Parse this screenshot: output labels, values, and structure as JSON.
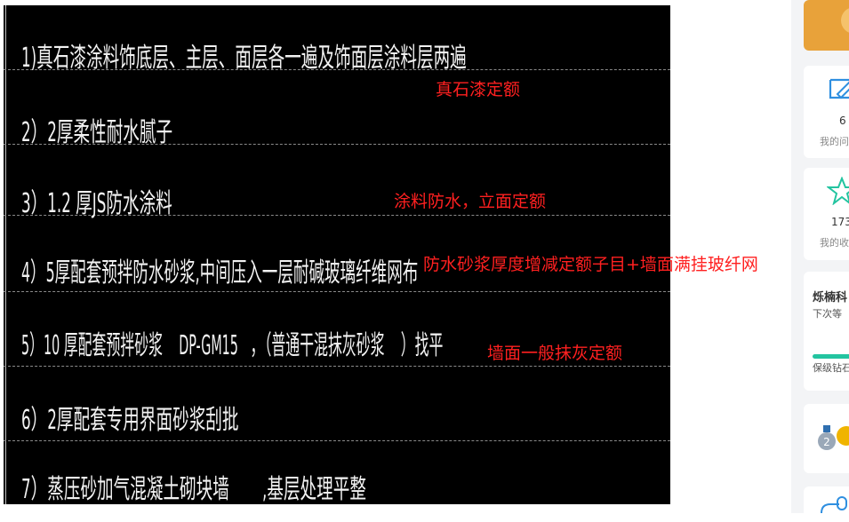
{
  "cad": {
    "lines": [
      "1)真石漆涂料饰底层、主层、面层各一遍及饰面层涂料层两遍",
      "2）2厚柔性耐水腻子",
      "3）1.2 厚JS防水涂料",
      "4）5厚配套预拌防水砂浆,中间压入一层耐碱玻璃纤维网布",
      "5）10 厚配套预拌砂浆    DP-GM15   ，（普通干混抹灰砂浆    ）找平",
      "6）2厚配套专用界面砂浆刮批",
      "7）蒸压砂加气混凝土砌块墙       ,基层处理平整"
    ]
  },
  "annotations": {
    "a1": "真石漆定额",
    "a2": "涂料防水，立面定额",
    "a3": "防水砂浆厚度增减定额子目+墙面满挂玻纤网",
    "a4": "墙面一般抹灰定额"
  },
  "sidebar": {
    "card1_count": "6",
    "card1_label": "我的问",
    "card2_count": "173",
    "card2_label": "我的收",
    "card3_title": "烁楠科",
    "card3_sub": "下次等",
    "card3_footer": "保级钻石"
  },
  "colors": {
    "annotation": "#ff2020",
    "accent": "#2f8fe0",
    "progress": "#23c4a0",
    "banner": "#e8a23a"
  }
}
